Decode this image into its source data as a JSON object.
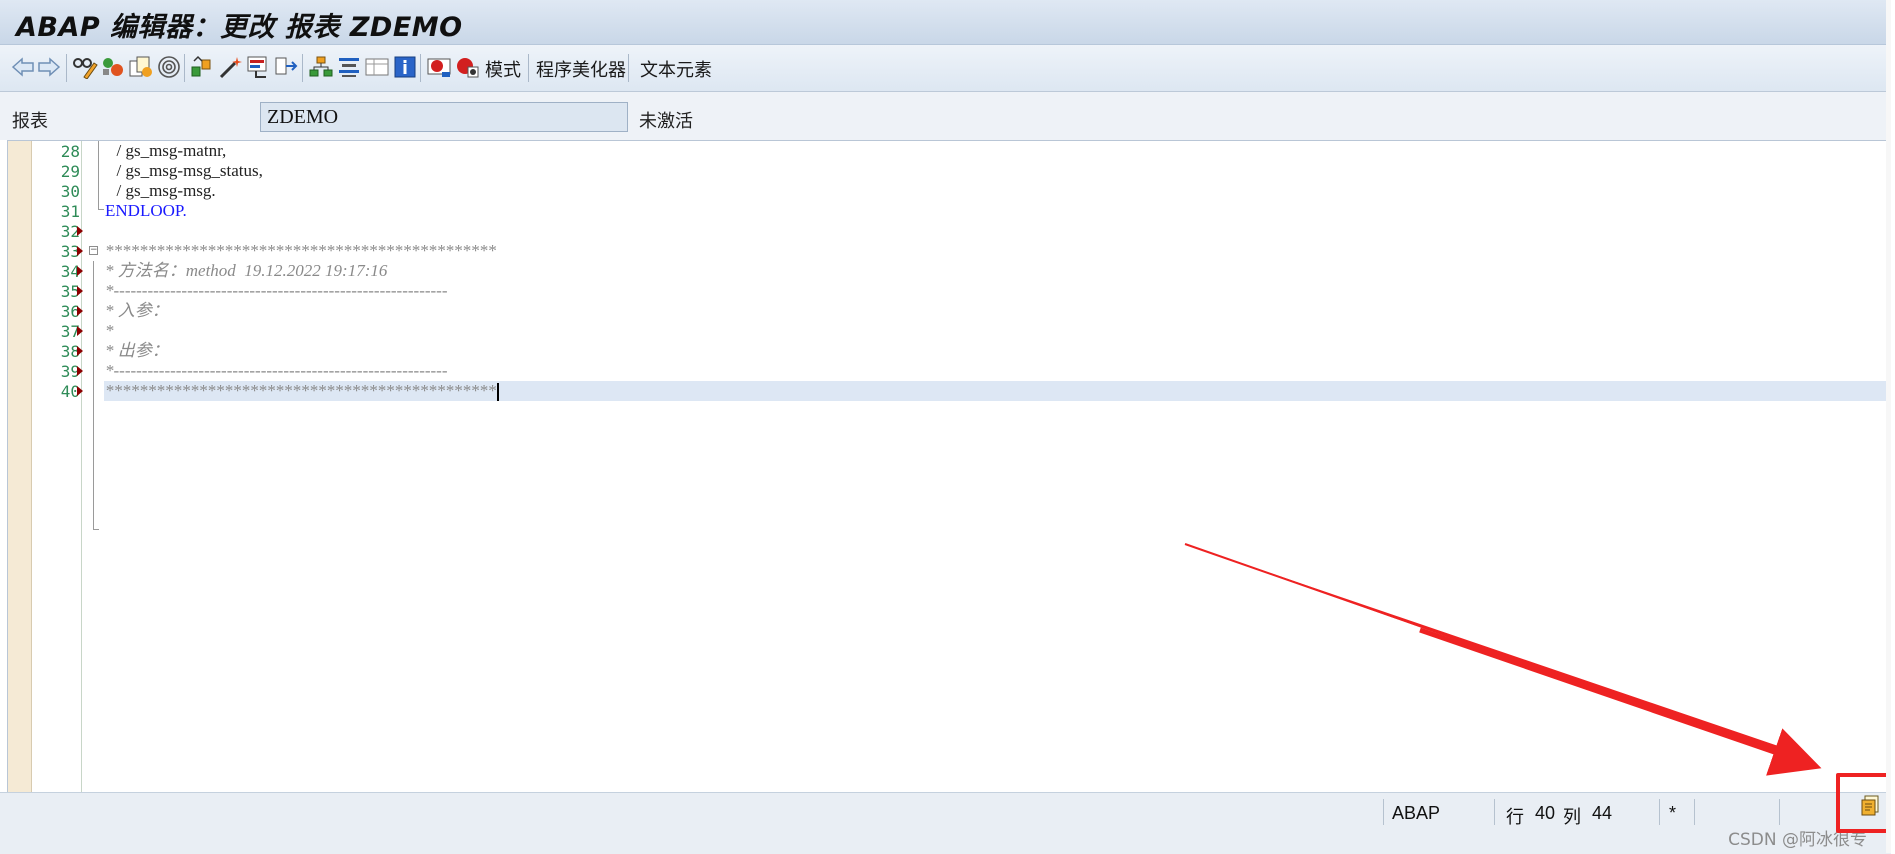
{
  "window": {
    "title": "ABAP 编辑器：更改 报表 ZDEMO"
  },
  "toolbar": {
    "icons": [
      "back-arrow-icon",
      "forward-arrow-icon",
      "glasses-pencil-icon",
      "object-toggle-icon",
      "copy-object-icon",
      "spiral-display-icon",
      "check-syntax-icon",
      "activate-wand-icon",
      "test-execute-icon",
      "where-used-icon",
      "object-list-icon",
      "navigation-window-icon",
      "display-object-list-icon",
      "info-icon",
      "breakpoint-session-icon",
      "breakpoint-external-icon"
    ],
    "buttons": {
      "pattern": "模式",
      "pretty_printer": "程序美化器",
      "text_elements": "文本元素"
    }
  },
  "report": {
    "label": "报表",
    "value": "ZDEMO",
    "status": "未激活"
  },
  "editor": {
    "lines": [
      {
        "num": "28",
        "text": "  / gs_msg-matnr,",
        "type": "code"
      },
      {
        "num": "29",
        "text": "  / gs_msg-msg_status,",
        "type": "code"
      },
      {
        "num": "30",
        "text": "  / gs_msg-msg.",
        "type": "code"
      },
      {
        "num": "31",
        "text": "ENDLOOP.",
        "type": "keyword"
      },
      {
        "num": "32",
        "text": "",
        "type": "code"
      },
      {
        "num": "33",
        "text": "*&---------------------------------------------------------------*",
        "type": "comment",
        "display": "**********************************************"
      },
      {
        "num": "34",
        "text": "* 方法名：method  19.12.2022 19:17:16",
        "type": "comment"
      },
      {
        "num": "35",
        "text": "*-----------------------------------------------------------",
        "type": "comment"
      },
      {
        "num": "36",
        "text": "* 入参：",
        "type": "comment"
      },
      {
        "num": "37",
        "text": "*",
        "type": "comment"
      },
      {
        "num": "38",
        "text": "* 出参：",
        "type": "comment"
      },
      {
        "num": "39",
        "text": "*-----------------------------------------------------------",
        "type": "comment"
      },
      {
        "num": "40",
        "text": "**********************************************",
        "type": "comment"
      }
    ]
  },
  "statusbar": {
    "language": "ABAP",
    "row_label": "行",
    "row": "40",
    "col_label": "列",
    "col": "44",
    "modified": "*",
    "watermark": "CSDN @阿冰很专"
  }
}
